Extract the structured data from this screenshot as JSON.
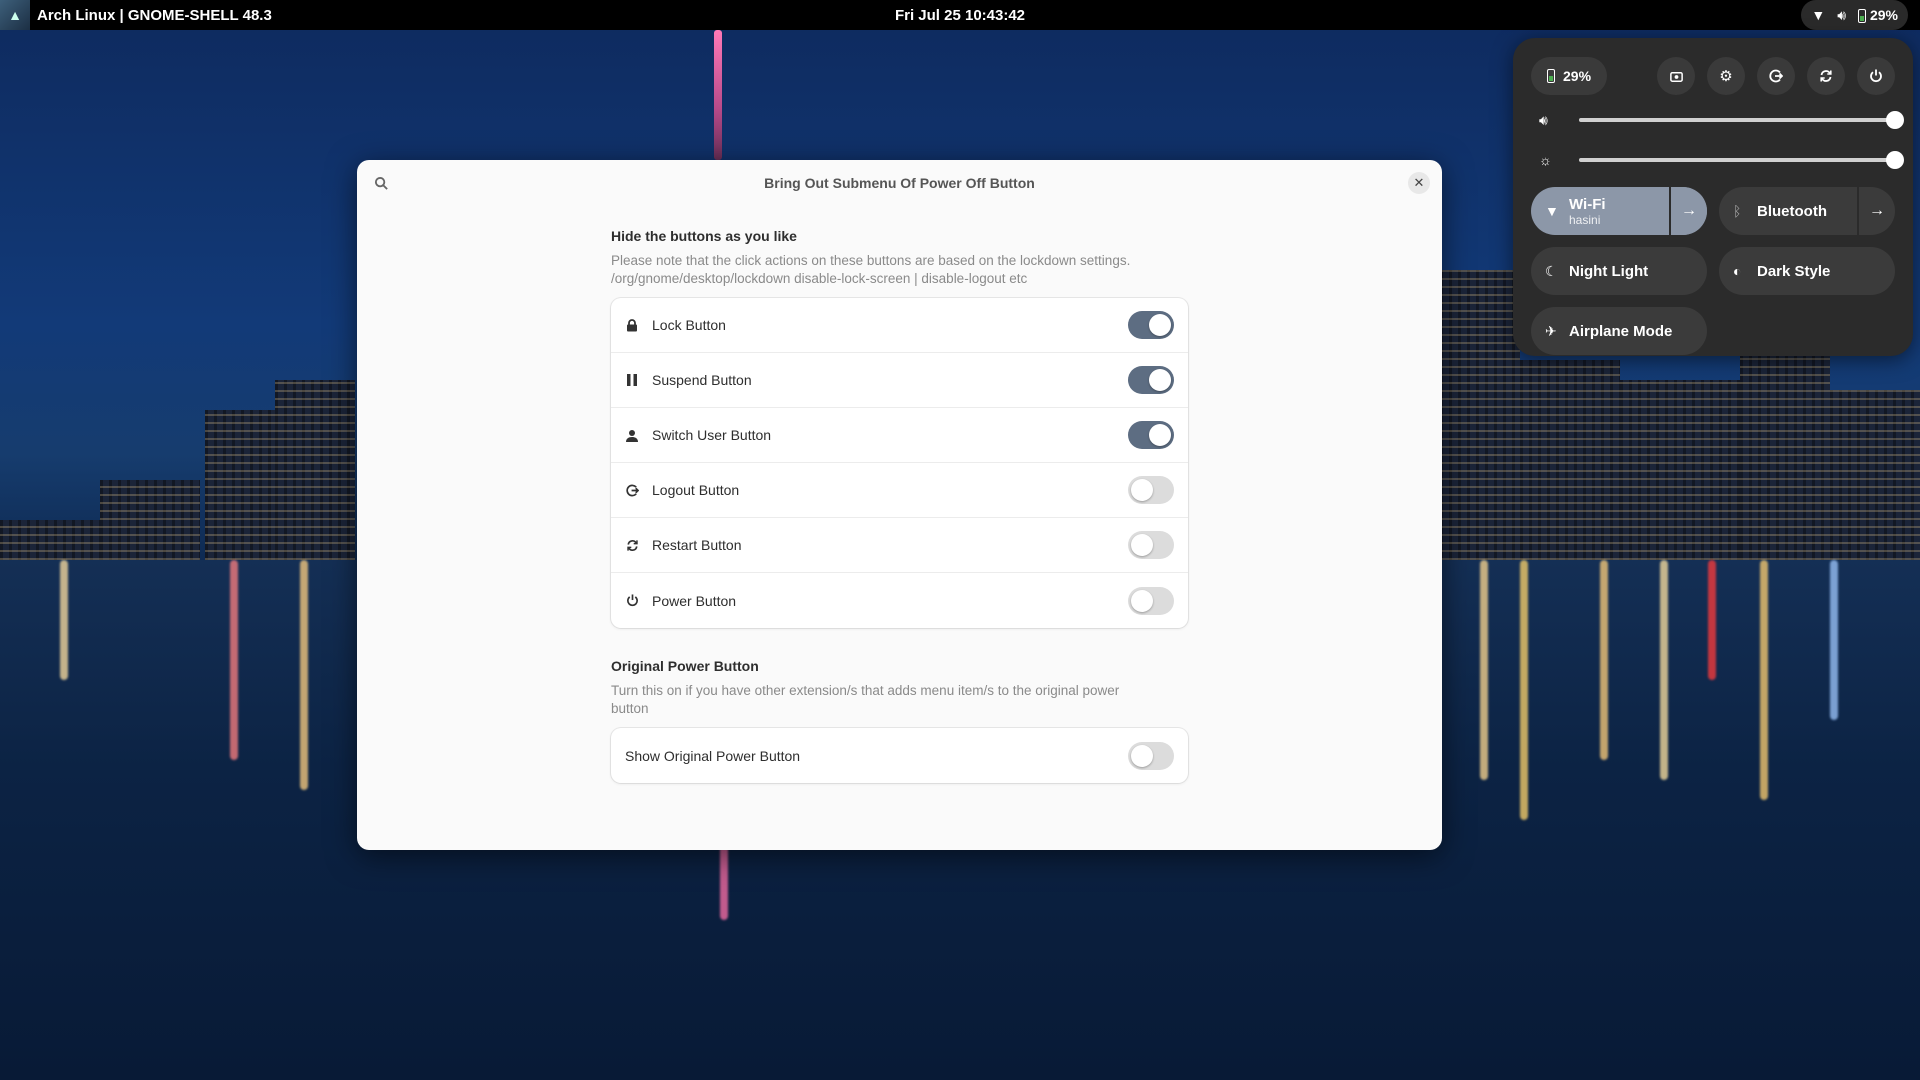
{
  "topbar": {
    "title": "Arch Linux | GNOME-SHELL 48.3",
    "clock": "Fri Jul 25  10:43:42",
    "battery": "29%"
  },
  "window": {
    "title": "Bring Out Submenu Of Power Off Button",
    "group1": {
      "title": "Hide the buttons as you like",
      "desc_line1": "Please note that the click actions on these buttons are based on the lockdown settings.",
      "desc_line2": "/org/gnome/desktop/lockdown disable-lock-screen | disable-logout etc",
      "rows": [
        {
          "label": "Lock Button",
          "icon": "lock-icon",
          "on": true
        },
        {
          "label": "Suspend Button",
          "icon": "pause-icon",
          "on": true
        },
        {
          "label": "Switch User Button",
          "icon": "user-icon",
          "on": true
        },
        {
          "label": "Logout Button",
          "icon": "logout-icon",
          "on": false
        },
        {
          "label": "Restart Button",
          "icon": "restart-icon",
          "on": false
        },
        {
          "label": "Power Button",
          "icon": "power-icon",
          "on": false
        }
      ]
    },
    "group2": {
      "title": "Original Power Button",
      "desc_line1": "Turn this on if you have other extension/s that adds menu item/s to the original power",
      "desc_line2": "button",
      "rows": [
        {
          "label": "Show Original Power Button",
          "on": false
        }
      ]
    }
  },
  "quick_settings": {
    "battery": "29%",
    "volume_level": 1.0,
    "brightness_level": 1.0,
    "tiles": {
      "wifi": {
        "label": "Wi-Fi",
        "sub": "hasini",
        "active": true
      },
      "bluetooth": {
        "label": "Bluetooth",
        "active": false
      },
      "night_light": {
        "label": "Night Light",
        "active": false
      },
      "dark_style": {
        "label": "Dark Style",
        "active": false
      },
      "airplane": {
        "label": "Airplane Mode",
        "active": false
      }
    }
  }
}
